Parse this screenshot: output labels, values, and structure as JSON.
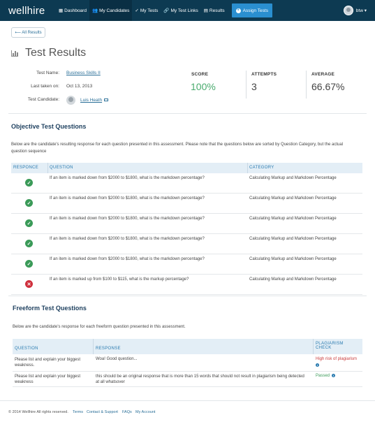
{
  "nav": {
    "logo": "wellhire",
    "items": [
      {
        "icon": "▦",
        "label": "Dashboard"
      },
      {
        "icon": "👥",
        "label": "My Candidates"
      },
      {
        "icon": "✓",
        "label": "My Tests"
      },
      {
        "icon": "🔗",
        "label": "My Test Links"
      },
      {
        "icon": "▤",
        "label": "Results"
      }
    ],
    "assign": "Assign Tests",
    "user": "btw"
  },
  "back_label": "⟵ All Results",
  "page_title": "Test Results",
  "info": {
    "test_name_label": "Test Name:",
    "test_name": "Business Skills II",
    "last_taken_label": "Last taken on:",
    "last_taken": "Oct 13, 2013",
    "candidate_label": "Test Candidate:",
    "candidate": "Luis Heath"
  },
  "stats": {
    "score_label": "SCORE",
    "score": "100%",
    "attempts_label": "ATTEMPTS",
    "attempts": "3",
    "average_label": "AVERAGE",
    "average": "66.67%"
  },
  "objective": {
    "title": "Objective Test Questions",
    "desc1": "Below are the candidate's resulting response for each question presented in this assessment. Please note that the questions below are sorted by Question Category, but the actual",
    "desc2": "question sequence",
    "headers": [
      "RESPONCE",
      "QUESTION",
      "CATEGORY"
    ],
    "rows": [
      {
        "status": "pass",
        "question": "If an item is marked down from $2000 to $1800, what is the markdown percentage?",
        "category": "Calculating Markup and Markdown Percentage"
      },
      {
        "status": "pass",
        "question": "If an item is marked down from $2000 to $1800, what is the markdown percentage?",
        "category": "Calculating Markup and Markdown Percentage"
      },
      {
        "status": "pass",
        "question": "If an item is marked down from $2000 to $1800, what is the markdown percentage?",
        "category": "Calculating Markup and Markdown Percentage"
      },
      {
        "status": "pass",
        "question": "If an item is marked down from $2000 to $1800, what is the markdown percentage?",
        "category": "Calculating Markup and Markdown Percentage"
      },
      {
        "status": "pass",
        "question": "If an item is marked down from $2000 to $1800, what is the markdown percentage?",
        "category": "Calculating Markup and Markdown Percentage"
      },
      {
        "status": "fail",
        "question": "If an item is marked up from $100 to $115, what is the markup percentage?",
        "category": "Calculating Markup and Markdown Percentage"
      }
    ]
  },
  "freeform": {
    "title": "Freeform Test Questions",
    "desc": "Below are the candidate's response for each freeform question presented in this assessment.",
    "headers": [
      "QUESTION",
      "RESPONSE",
      "PLAGIARISM",
      "CHECK"
    ],
    "rows": [
      {
        "question1": "Please list and explain your biggest",
        "question2": "weakness.",
        "response1": "Woa! Good question...",
        "response2": "",
        "plagiarism": "High risk of plagiarism"
      },
      {
        "question1": "Please list and explain your biggest",
        "question2": "weakness",
        "response1": "this should be an original response that is more than 15 words that should not result in plagiarism being detected",
        "response2": "at all whatsover",
        "plagiarism": "Passed"
      }
    ]
  },
  "footer": {
    "copyright": "© 2014 Wellhire All rights reserved.",
    "links": [
      "Terms",
      "Contact & Support",
      "FAQs",
      "My Account"
    ]
  },
  "colors": {
    "nav_bg": "#0d3a52",
    "accent": "#2a8fd0",
    "pass": "#3a9a58",
    "fail": "#cf2f3c",
    "table_header_bg": "#e3eef6"
  }
}
